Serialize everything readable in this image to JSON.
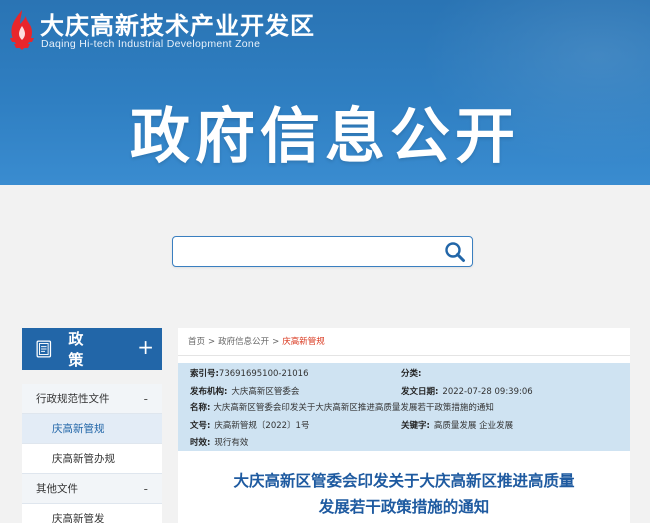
{
  "header": {
    "site_name_cn": "大庆高新技术产业开发区",
    "site_name_en": "Daqing Hi-tech Industrial Development Zone",
    "hero_title": "政府信息公开",
    "logo_icon": "flame-logo-icon"
  },
  "search": {
    "value": "",
    "placeholder": "",
    "icon": "search-icon"
  },
  "sidebar": {
    "title": "政 策",
    "expand_symbol": "+",
    "items": [
      {
        "label": "行政规范性文件",
        "type": "group",
        "toggle": "-"
      },
      {
        "label": "庆高新管规",
        "type": "sub",
        "active": true
      },
      {
        "label": "庆高新管办规",
        "type": "sub"
      },
      {
        "label": "其他文件",
        "type": "group",
        "toggle": "-"
      },
      {
        "label": "庆高新管发",
        "type": "sub"
      }
    ]
  },
  "breadcrumb": {
    "items": [
      "首页",
      "政府信息公开",
      "庆高新管规"
    ],
    "separator": ">"
  },
  "meta": {
    "index_label": "索引号:",
    "index_value": "73691695100-21016",
    "category_label": "分类:",
    "category_value": "",
    "publisher_label": "发布机构:",
    "publisher_value": "大庆高新区管委会",
    "date_label": "发文日期:",
    "date_value": "2022-07-28 09:39:06",
    "name_label": "名称:",
    "name_value": "大庆高新区管委会印发关于大庆高新区推进高质量发展若干政策措施的通知",
    "docno_label": "文号:",
    "docno_value": "庆高新管规〔2022〕1号",
    "keywords_label": "关键字:",
    "keywords_value": "高质量发展 企业发展",
    "validity_label": "时效:",
    "validity_value": "现行有效"
  },
  "document": {
    "title_line1": "大庆高新区管委会印发关于大庆高新区推进高质量",
    "title_line2": "发展若干政策措施的通知"
  },
  "colors": {
    "banner_blue": "#2f7fc2",
    "sidebar_head": "#2266a8",
    "meta_bg": "#cfe3f2",
    "title_blue": "#1e5aa0",
    "breadcrumb_current": "#d9361c"
  }
}
